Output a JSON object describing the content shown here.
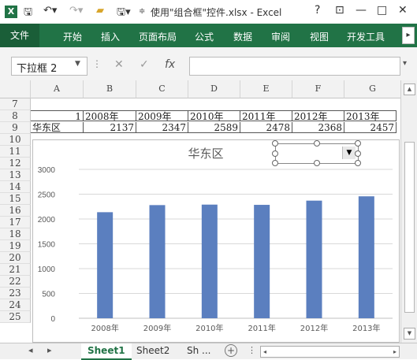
{
  "titlebar": {
    "logo": "X",
    "title": "使用\"组合框\"控件.xlsx - Excel",
    "help": "?",
    "restore_ribbon": "⊡",
    "minimize": "—",
    "maximize": "□",
    "close": "✕"
  },
  "ribbon": {
    "tabs": [
      "文件",
      "开始",
      "插入",
      "页面布局",
      "公式",
      "数据",
      "审阅",
      "视图",
      "开发工具"
    ]
  },
  "formula_bar": {
    "name_box": "下拉框 2",
    "cancel_symbol": "✕",
    "enter_symbol": "✓",
    "fx_symbol": "fx",
    "formula_value": ""
  },
  "sheet": {
    "columns": [
      "A",
      "B",
      "C",
      "D",
      "E",
      "F",
      "G"
    ],
    "rows": [
      "7",
      "8",
      "9",
      "10",
      "11",
      "12",
      "13",
      "14",
      "15",
      "16",
      "17",
      "18",
      "19",
      "20",
      "21",
      "22",
      "23",
      "24",
      "25"
    ],
    "row8": [
      "1",
      "2008年",
      "2009年",
      "2010年",
      "2011年",
      "2012年",
      "2013年"
    ],
    "row9": [
      "华东区",
      "2137",
      "2347",
      "2589",
      "2478",
      "2368",
      "2457"
    ]
  },
  "chart_data": {
    "type": "bar",
    "title": "华东区",
    "categories": [
      "2008年",
      "2009年",
      "2010年",
      "2011年",
      "2012年",
      "2013年"
    ],
    "values": [
      2137,
      2280,
      2290,
      2285,
      2370,
      2457
    ],
    "ylim": [
      0,
      3000
    ],
    "yticks": [
      "0",
      "500",
      "1000",
      "1500",
      "2000",
      "2500",
      "3000"
    ],
    "grid": true,
    "bar_color": "#5b7fbf"
  },
  "tabs": {
    "sheets": [
      "Sheet1",
      "Sheet2",
      "Sh ..."
    ],
    "add": "+",
    "more": "⋮"
  },
  "colors": {
    "excel_green": "#217346"
  }
}
